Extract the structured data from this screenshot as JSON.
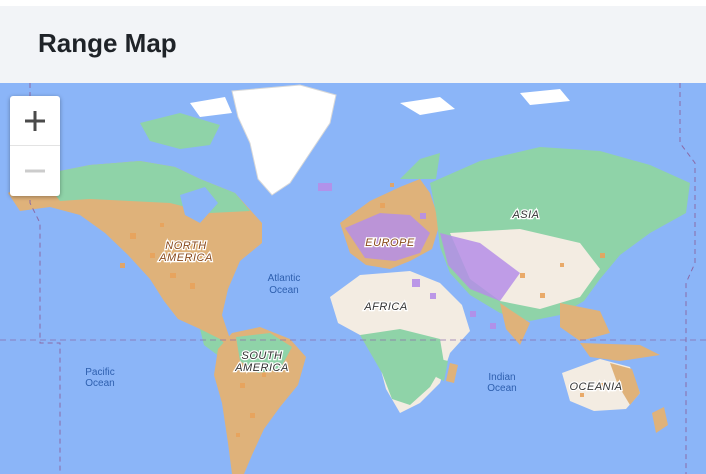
{
  "header": {
    "title": "Range Map"
  },
  "zoom": {
    "in_symbol": "+",
    "out_symbol": "−",
    "out_disabled": true
  },
  "map": {
    "continent_labels": {
      "north_america": [
        "NORTH",
        "AMERICA"
      ],
      "south_america": [
        "SOUTH",
        "AMERICA"
      ],
      "europe": "EUROPE",
      "africa": "AFRICA",
      "asia": "ASIA",
      "oceania": "OCEANIA"
    },
    "ocean_labels": {
      "atlantic": [
        "Atlantic",
        "Ocean"
      ],
      "pacific": [
        "Pacific",
        "Ocean"
      ],
      "indian": [
        "Indian",
        "Ocean"
      ]
    },
    "colors": {
      "ocean": "#8bb5f8",
      "land_green": "#8fd3a8",
      "land_tan": "#dfb27a",
      "land_desert": "#f3ece2",
      "ice": "#ffffff",
      "range_purple": "#b58ee8",
      "range_orange": "#e8a35c",
      "dateline": "#8a6aa8"
    }
  }
}
